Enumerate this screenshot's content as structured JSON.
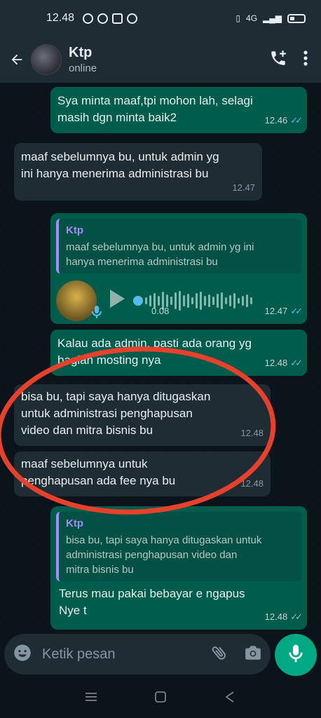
{
  "status_bar": {
    "time": "12.48",
    "network": "4G"
  },
  "header": {
    "name": "Ktp",
    "status": "online"
  },
  "messages": [
    {
      "direction": "out",
      "text_line1": "Sya minta maaf,tpi mohon lah, selagi",
      "text_line2": "masih dgn minta baik2",
      "time": "12.46",
      "read": true
    },
    {
      "direction": "in",
      "text_line1": "maaf sebelumnya bu, untuk admin yg",
      "text_line2": "ini hanya menerima administrasi bu",
      "time": "12.47"
    },
    {
      "direction": "out",
      "quote_name": "Ktp",
      "quote_line1": "maaf sebelumnya bu, untuk admin yg ini",
      "quote_line2": "hanya menerima administrasi bu",
      "voice_duration": "0.08",
      "time": "12.47",
      "read": true
    },
    {
      "direction": "out",
      "text_line1": "Kalau ada admin, pasti ada orang yg",
      "text_line2": "bagian mosting nya",
      "time": "12.48",
      "read": true
    },
    {
      "direction": "in",
      "text_line1": "bisa bu, tapi saya hanya ditugaskan",
      "text_line2": "untuk administrasi penghapusan",
      "text_line3": "video dan mitra bisnis bu",
      "time": "12.48"
    },
    {
      "direction": "in",
      "text_line1": "maaf sebelumnya untuk",
      "text_line2": "penghapusan ada fee nya bu",
      "time": "12.48"
    },
    {
      "direction": "out",
      "quote_name": "Ktp",
      "quote_line1": "bisa bu, tapi saya hanya ditugaskan untuk",
      "quote_line2": "administrasi penghapusan video dan",
      "quote_line3": "mitra bisnis bu",
      "text_line1": "Terus mau pakai bebayar e ngapus",
      "text_line2": "Nye t",
      "time": "12.48",
      "read": false
    }
  ],
  "composer": {
    "placeholder": "Ketik pesan"
  },
  "colors": {
    "accent": "#00a884",
    "outgoing": "#005c4b",
    "incoming": "#202c33",
    "annotation": "#e8412b",
    "read_ticks": "#53bdeb"
  },
  "icons": [
    "back-arrow-icon",
    "add-call-icon",
    "more-vert-icon",
    "emoji-icon",
    "attach-icon",
    "camera-icon",
    "mic-icon",
    "play-icon"
  ]
}
